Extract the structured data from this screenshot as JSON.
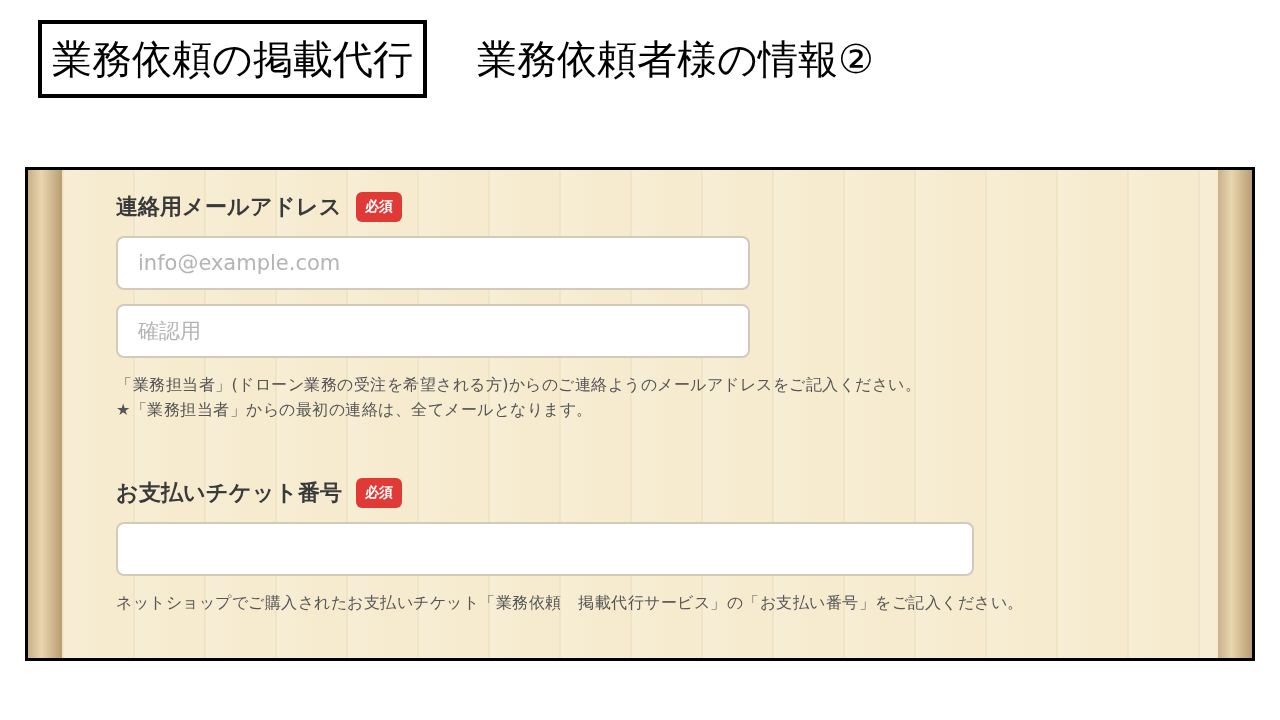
{
  "slide": {
    "title": "業務依頼の掲載代行",
    "subtitle": "業務依頼者様の情報②"
  },
  "form": {
    "fields": [
      {
        "label": "連絡用メールアドレス",
        "required_badge": "必須",
        "inputs": [
          {
            "kind": "medium",
            "placeholder": "info@example.com"
          },
          {
            "kind": "medium",
            "placeholder": "確認用"
          }
        ],
        "notes": [
          "「業務担当者」(ドローン業務の受注を希望される方)からのご連絡ようのメールアドレスをご記入ください。",
          "★「業務担当者」からの最初の連絡は、全てメールとなります。"
        ]
      },
      {
        "label": "お支払いチケット番号",
        "required_badge": "必須",
        "inputs": [
          {
            "kind": "wide"
          }
        ],
        "notes": [
          "ネットショップでご購入されたお支払いチケット「業務依頼　掲載代行サービス」の「お支払い番号」をご記入ください。"
        ]
      }
    ]
  }
}
